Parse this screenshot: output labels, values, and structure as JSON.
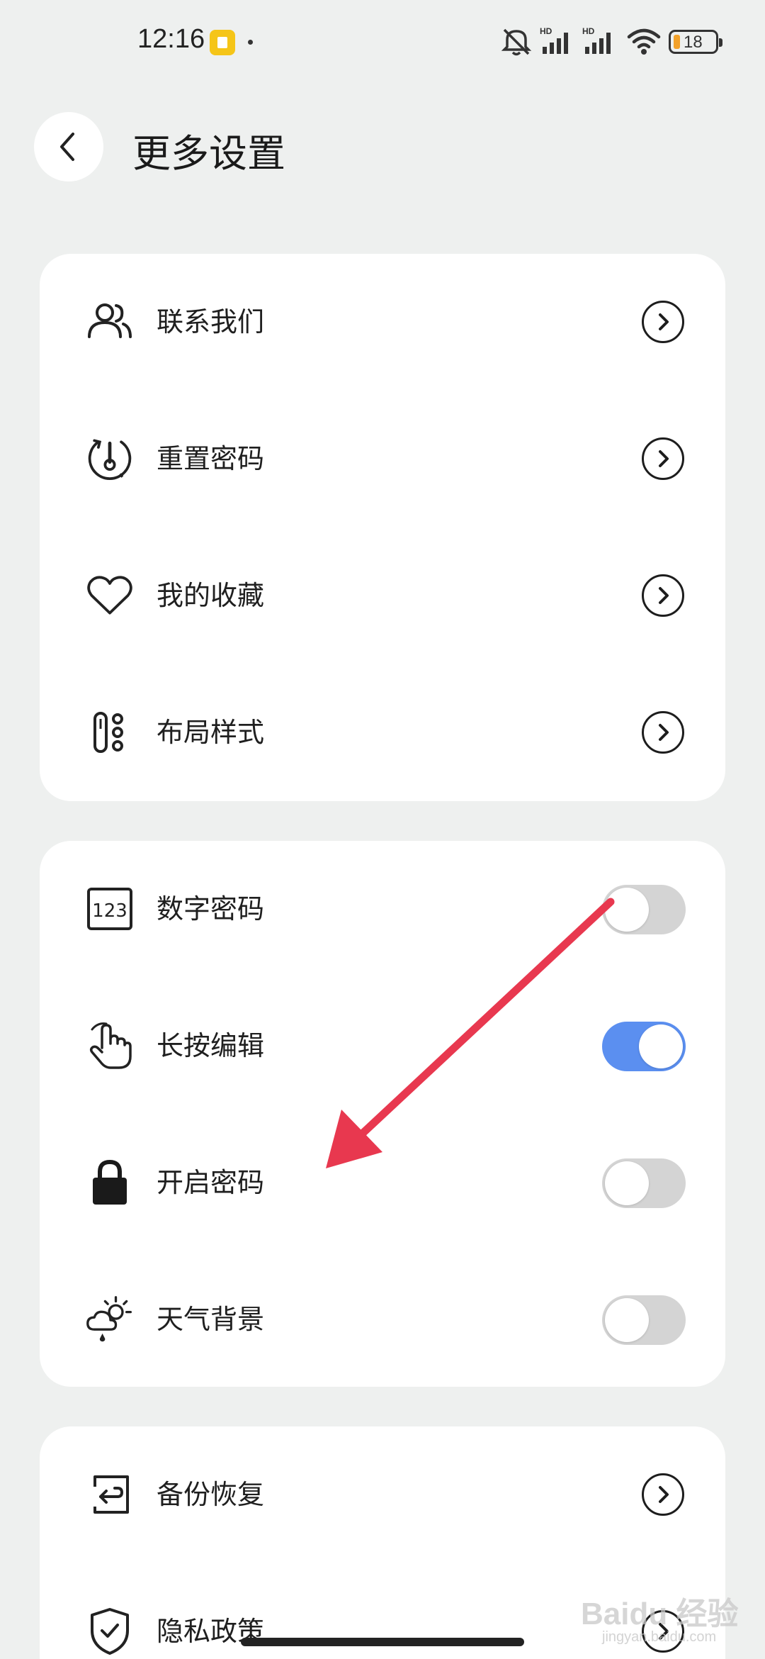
{
  "status_bar": {
    "time": "12:16",
    "battery": "18",
    "icons": [
      "app-notification-icon",
      "mute-icon",
      "hd-signal-icon",
      "hd-signal-icon",
      "wifi-icon",
      "battery-icon"
    ]
  },
  "header": {
    "title": "更多设置",
    "back_icon": "chevron-left-icon"
  },
  "card1": {
    "items": [
      {
        "label": "联系我们",
        "icon": "contacts-icon",
        "control": "chevron"
      },
      {
        "label": "重置密码",
        "icon": "reset-password-icon",
        "control": "chevron"
      },
      {
        "label": "我的收藏",
        "icon": "heart-icon",
        "control": "chevron"
      },
      {
        "label": "布局样式",
        "icon": "layout-icon",
        "control": "chevron"
      }
    ]
  },
  "card2": {
    "items": [
      {
        "label": "数字密码",
        "icon": "numeric-123-icon",
        "control": "toggle",
        "on": false
      },
      {
        "label": "长按编辑",
        "icon": "hand-pointer-icon",
        "control": "toggle",
        "on": true
      },
      {
        "label": "开启密码",
        "icon": "lock-icon",
        "control": "toggle",
        "on": false
      },
      {
        "label": "天气背景",
        "icon": "weather-icon",
        "control": "toggle",
        "on": false
      }
    ]
  },
  "card3": {
    "items": [
      {
        "label": "备份恢复",
        "icon": "backup-restore-icon",
        "control": "chevron"
      },
      {
        "label": "隐私政策",
        "icon": "shield-check-icon",
        "control": "chevron"
      }
    ]
  },
  "colors": {
    "background": "#eef0ef",
    "card": "#ffffff",
    "toggle_on": "#5b8ff0",
    "toggle_off": "#d4d4d4",
    "annotation_arrow": "#e8384f"
  },
  "watermark": {
    "brand": "Baidu 经验",
    "url": "jingyan.baidu.com"
  }
}
